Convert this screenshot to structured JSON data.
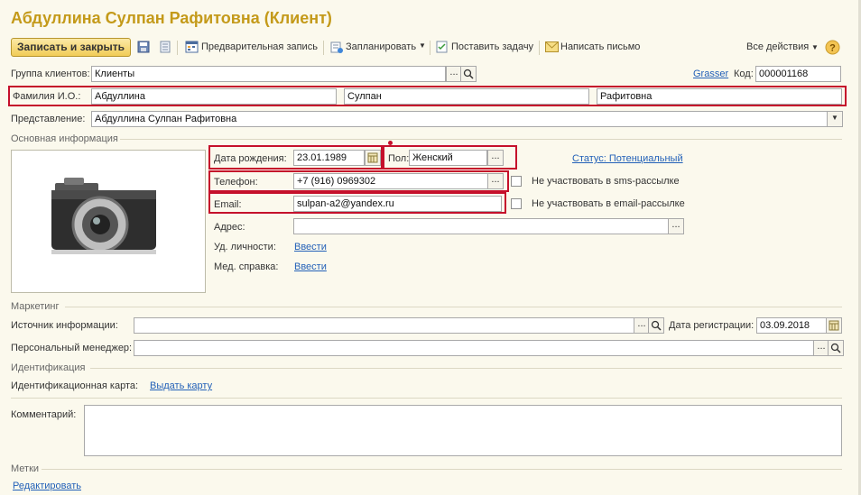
{
  "window": {
    "title": "Абдуллина Сулпан Рафитовна (Клиент)"
  },
  "toolbar": {
    "save_close": "Записать и закрыть",
    "preliminary": "Предварительная запись",
    "schedule": "Запланировать",
    "set_task": "Поставить задачу",
    "write_letter": "Написать письмо",
    "all_actions": "Все действия"
  },
  "header": {
    "client_group_label": "Группа клиентов:",
    "client_group_value": "Клиенты",
    "grasser": "Grasser",
    "code_label": "Код:",
    "code_value": "000001168",
    "fio_label": "Фамилия И.О.:",
    "last_name": "Абдуллина",
    "first_name": "Сулпан",
    "middle_name": "Рафитовна",
    "representation_label": "Представление:",
    "representation_value": "Абдуллина Сулпан Рафитовна"
  },
  "basic": {
    "group_title": "Основная информация",
    "birth_label": "Дата рождения:",
    "birth_value": "23.01.1989",
    "gender_label": "Пол:",
    "gender_value": "Женский",
    "status": "Статус: Потенциальный",
    "phone_label": "Телефон:",
    "phone_value": "+7 (916) 0969302",
    "sms_opt_out": "Не участвовать в sms-рассылке",
    "email_label": "Email:",
    "email_value": "sulpan-a2@yandex.ru",
    "email_opt_out": "Не участвовать в email-рассылке",
    "address_label": "Адрес:",
    "id_doc_label": "Уд. личности:",
    "id_doc_link": "Ввести",
    "med_label": "Мед. справка:",
    "med_link": "Ввести"
  },
  "marketing": {
    "group_title": "Маркетинг",
    "source_label": "Источник информации:",
    "reg_date_label": "Дата регистрации:",
    "reg_date_value": "03.09.2018",
    "manager_label": "Персональный менеджер:"
  },
  "identification": {
    "group_title": "Идентификация",
    "card_label": "Идентификационная карта:",
    "card_link": "Выдать карту"
  },
  "comment": {
    "label": "Комментарий:"
  },
  "tags": {
    "group_title": "Метки",
    "edit_link": "Редактировать"
  },
  "colors": {
    "title": "#c49a1a",
    "highlight": "#c5102b",
    "link": "#2361b8",
    "background": "#fbf9ed"
  }
}
